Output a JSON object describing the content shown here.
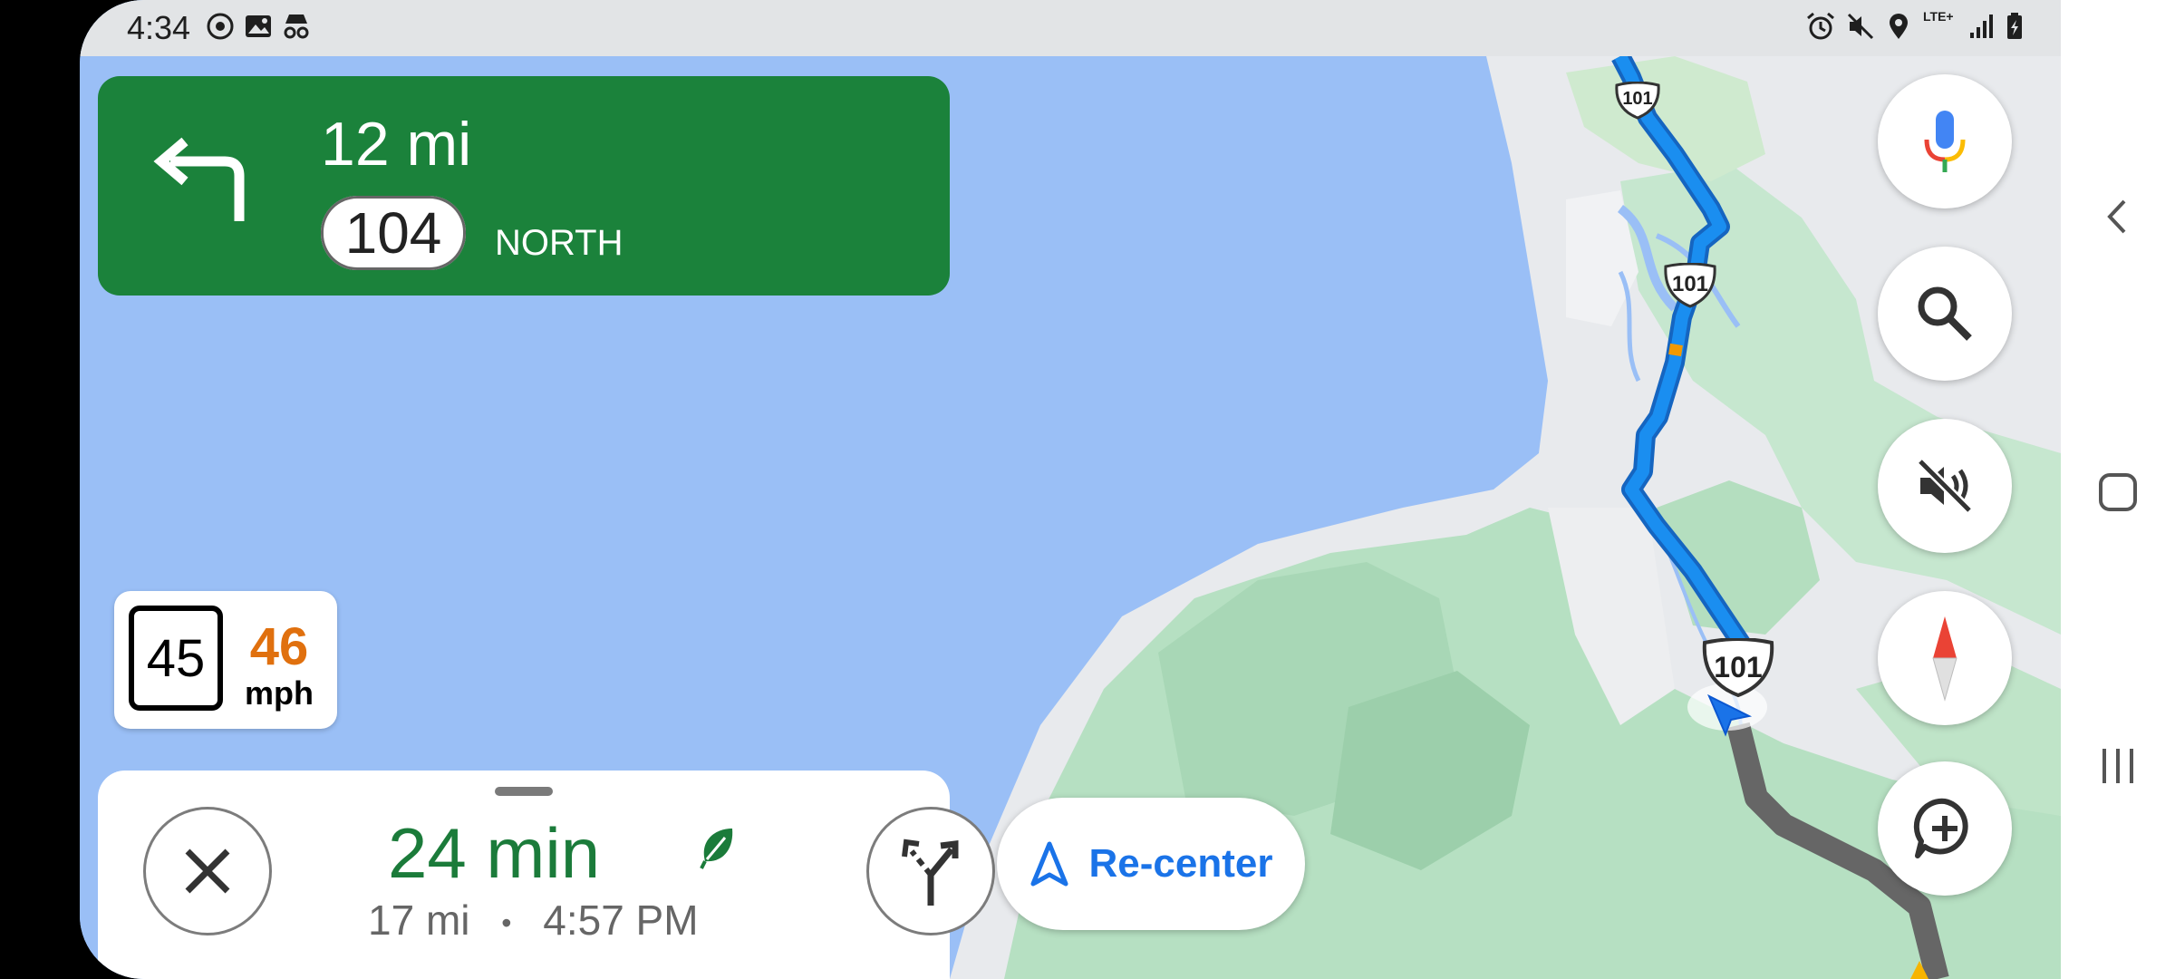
{
  "status_bar": {
    "time": "4:34",
    "left_icons": [
      "location-target-icon",
      "image-icon",
      "incognito-icon"
    ],
    "right_icons": [
      "alarm-icon",
      "mute-icon",
      "location-pin-icon",
      "lte-icon",
      "signal-icon",
      "battery-charging-icon"
    ],
    "network_label": "LTE+"
  },
  "direction": {
    "distance": "12 mi",
    "road_number": "104",
    "road_direction": "NORTH",
    "maneuver_icon": "turn-left-icon"
  },
  "speed": {
    "limit": "45",
    "current": "46",
    "unit": "mph"
  },
  "trip": {
    "eta_duration": "24 min",
    "distance": "17 mi",
    "separator": "•",
    "arrival_time": "4:57 PM",
    "eco_icon": "leaf-icon"
  },
  "recenter": {
    "label": "Re-center"
  },
  "map": {
    "shields": [
      "101",
      "101",
      "101"
    ],
    "colors": {
      "water": "#9abff6",
      "land": "#e8eaed",
      "green": "#b9e2c4",
      "route": "#1a8ef0",
      "route_gray": "#666666"
    }
  },
  "fabs": [
    "mic-icon",
    "search-icon",
    "mute-icon",
    "compass-icon",
    "add-report-icon"
  ],
  "nav_bar": [
    "back-icon",
    "home-icon",
    "recents-icon"
  ]
}
